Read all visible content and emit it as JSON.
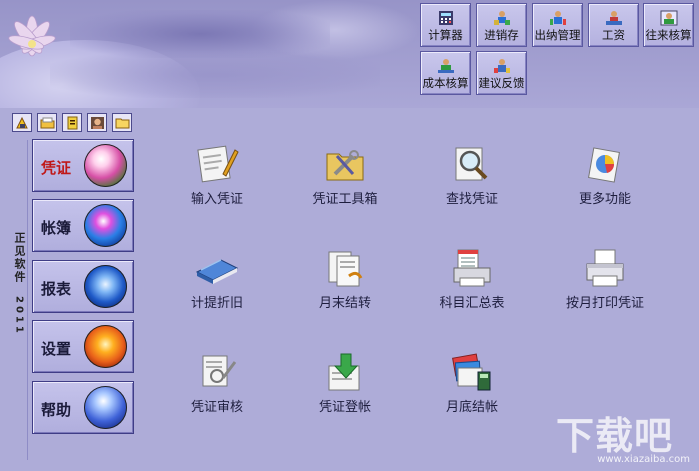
{
  "top_toolbar": [
    {
      "label": "计算器",
      "icon": "calculator-icon"
    },
    {
      "label": "进销存",
      "icon": "inventory-icon"
    },
    {
      "label": "出纳管理",
      "icon": "cashier-icon"
    },
    {
      "label": "工资",
      "icon": "salary-icon"
    },
    {
      "label": "往来核算",
      "icon": "accounts-icon"
    },
    {
      "label": "成本核算",
      "icon": "cost-icon"
    },
    {
      "label": "建议反馈",
      "icon": "feedback-icon"
    }
  ],
  "mini_toolbar": [
    "new-icon",
    "open-folder-icon",
    "notebook-icon",
    "user-photo-icon",
    "folder-icon"
  ],
  "side_title": {
    "text": "正见软件",
    "year": "2011"
  },
  "nav": [
    {
      "label": "凭证",
      "active": true,
      "orb": "flower"
    },
    {
      "label": "帐簿",
      "active": false,
      "orb": "butterfly"
    },
    {
      "label": "报表",
      "active": false,
      "orb": "knot"
    },
    {
      "label": "设置",
      "active": false,
      "orb": "swirl"
    },
    {
      "label": "帮助",
      "active": false,
      "orb": "glass"
    }
  ],
  "tiles": [
    {
      "label": "输入凭证",
      "icon": "voucher-pen-icon"
    },
    {
      "label": "凭证工具箱",
      "icon": "toolbox-icon"
    },
    {
      "label": "查找凭证",
      "icon": "magnifier-icon"
    },
    {
      "label": "更多功能",
      "icon": "more-functions-icon"
    },
    {
      "label": "计提折旧",
      "icon": "book-icon"
    },
    {
      "label": "月末结转",
      "icon": "month-end-icon"
    },
    {
      "label": "科目汇总表",
      "icon": "printer-sheet-icon"
    },
    {
      "label": "按月打印凭证",
      "icon": "printer-icon"
    },
    {
      "label": "凭证审核",
      "icon": "audit-icon"
    },
    {
      "label": "凭证登帐",
      "icon": "post-arrow-icon"
    },
    {
      "label": "月底结帐",
      "icon": "calculator-cards-icon"
    }
  ],
  "watermark": {
    "big": "下载吧",
    "small": "www.xiazaiba.com"
  },
  "colors": {
    "background": "#aeacd8",
    "active_nav_text": "#c01818",
    "border": "#3f3d86"
  }
}
